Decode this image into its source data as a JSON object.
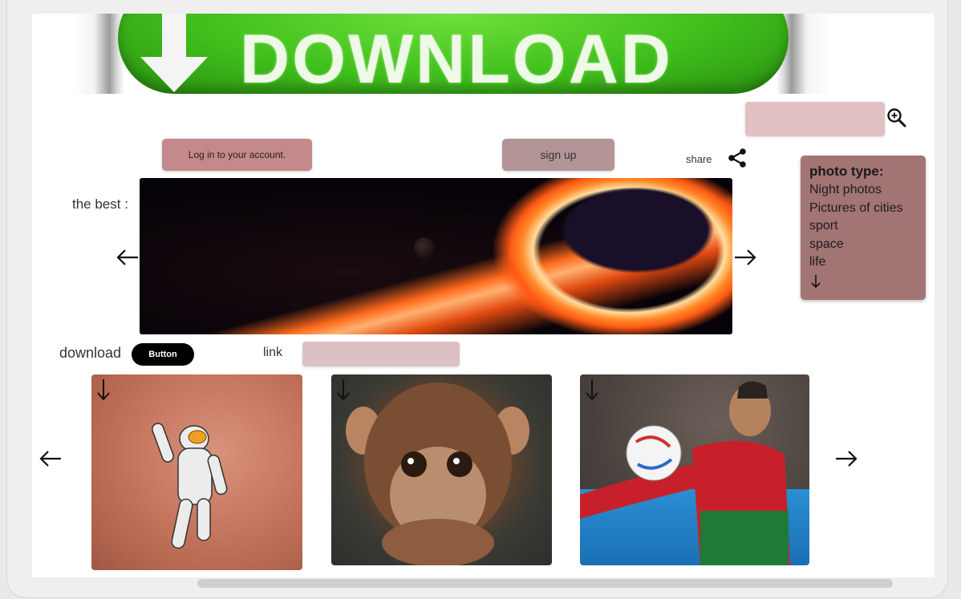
{
  "banner": {
    "text": "DOWNLOAD"
  },
  "search": {
    "placeholder": ""
  },
  "header": {
    "login_label": "Log in to your account.",
    "signup_label": "sign up",
    "share_label": "share"
  },
  "sidebar": {
    "title": "photo type:",
    "items": [
      "Night photos",
      "Pictures of cities",
      "sport",
      "space",
      "life"
    ]
  },
  "hero": {
    "label": "the best :"
  },
  "download": {
    "label": "download",
    "button_label": "Button"
  },
  "link": {
    "label": "link",
    "value": ""
  },
  "colors": {
    "login_button": "#c4898b",
    "signup_button": "#b39597",
    "search_field": "#e2c1c3",
    "sidebar_bg": "#a27474",
    "link_field": "#dcc1c4",
    "primary_button": "#000000"
  },
  "icons": [
    "download-arrow-icon",
    "search-icon",
    "share-icon",
    "arrow-left-icon",
    "arrow-right-icon",
    "arrow-down-icon"
  ]
}
